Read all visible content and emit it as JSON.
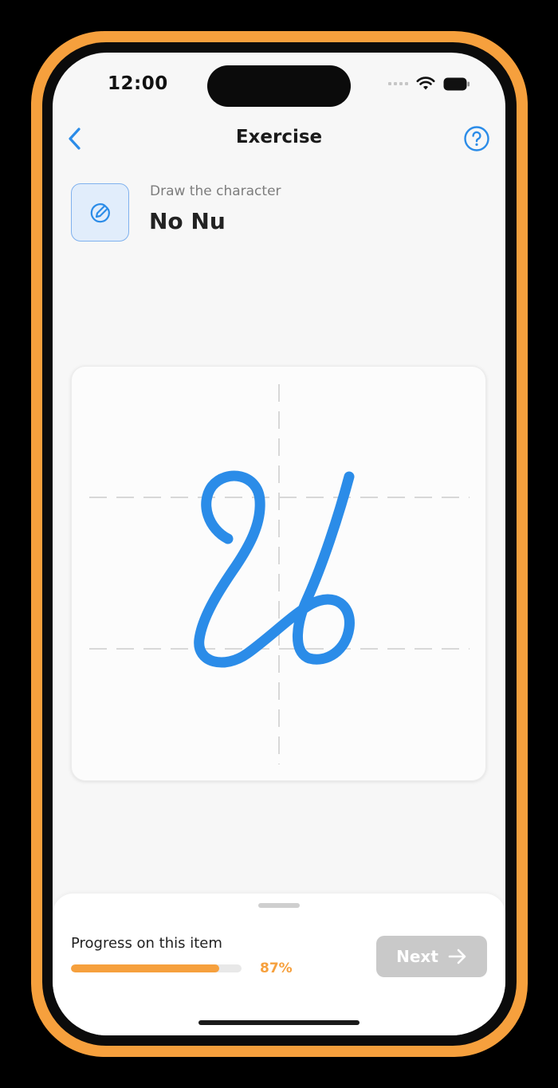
{
  "status_bar": {
    "time": "12:00"
  },
  "nav": {
    "title": "Exercise",
    "back_icon": "chevron-left-icon",
    "help_icon": "question-circle-icon"
  },
  "prompt": {
    "icon": "pencil-circle-icon",
    "subtitle": "Draw the character",
    "title": "No Nu"
  },
  "progress": {
    "label": "Progress on this item",
    "value": 0.87,
    "percent_text": "87%"
  },
  "next_button": {
    "label": "Next",
    "icon": "arrow-right-icon",
    "enabled": false
  },
  "colors": {
    "accent": "#2B8CE8",
    "frame": "#F6A03D",
    "progress": "#F6A03D",
    "disabled_button": "#C9C9C9"
  }
}
